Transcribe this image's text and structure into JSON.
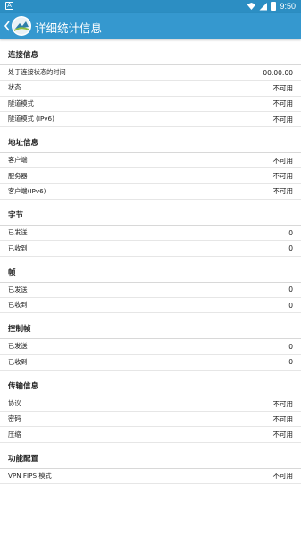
{
  "status_bar": {
    "time": "9:50",
    "left_icon": "A"
  },
  "app_bar": {
    "title": "详细统计信息",
    "back_icon": "back-arrow-icon",
    "logo_icon": "app-logo-icon"
  },
  "sections": [
    {
      "title": "连接信息",
      "rows": [
        {
          "label": "处于连接状态的时间",
          "value": "00:00:00"
        },
        {
          "label": "状态",
          "value": "不可用"
        },
        {
          "label": "隧道模式",
          "value": "不可用"
        },
        {
          "label": "隧道模式 (IPv6)",
          "value": "不可用"
        }
      ]
    },
    {
      "title": "地址信息",
      "rows": [
        {
          "label": "客户端",
          "value": "不可用"
        },
        {
          "label": "服务器",
          "value": "不可用"
        },
        {
          "label": "客户端(IPv6)",
          "value": "不可用"
        }
      ]
    },
    {
      "title": "字节",
      "rows": [
        {
          "label": "已发送",
          "value": "0"
        },
        {
          "label": "已收到",
          "value": "0"
        }
      ]
    },
    {
      "title": "帧",
      "rows": [
        {
          "label": "已发送",
          "value": "0"
        },
        {
          "label": "已收到",
          "value": "0"
        }
      ]
    },
    {
      "title": "控制帧",
      "rows": [
        {
          "label": "已发送",
          "value": "0"
        },
        {
          "label": "已收到",
          "value": "0"
        }
      ]
    },
    {
      "title": "传输信息",
      "rows": [
        {
          "label": "协议",
          "value": "不可用"
        },
        {
          "label": "密码",
          "value": "不可用"
        },
        {
          "label": "压缩",
          "value": "不可用"
        }
      ]
    },
    {
      "title": "功能配置",
      "rows": [
        {
          "label": "VPN FIPS 模式",
          "value": "不可用"
        }
      ]
    }
  ]
}
